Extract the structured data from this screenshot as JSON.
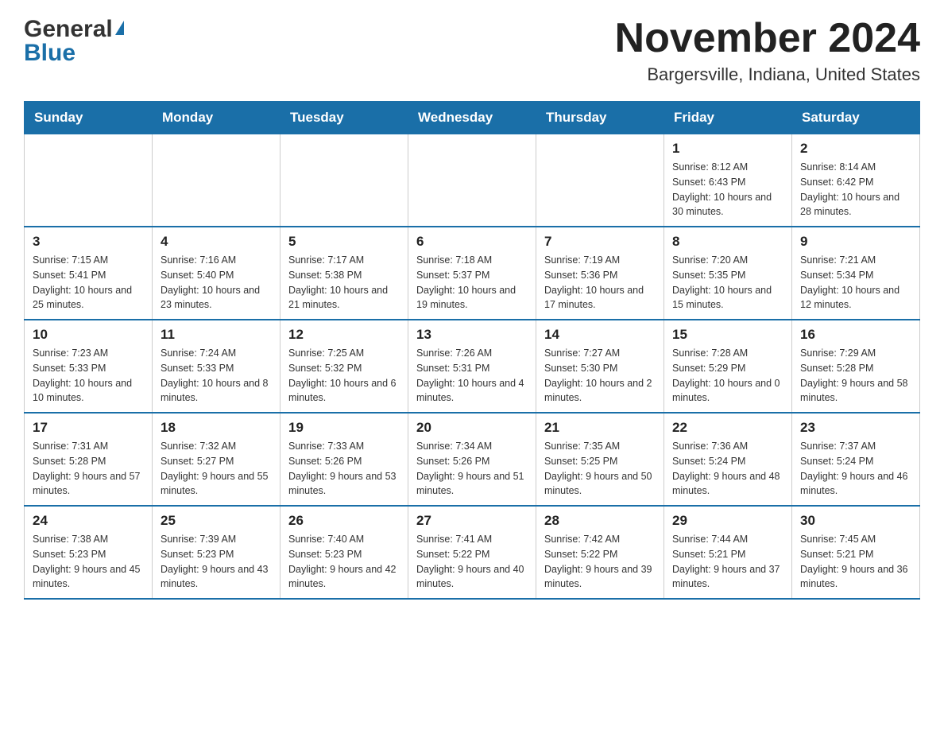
{
  "logo": {
    "general": "General",
    "blue": "Blue"
  },
  "header": {
    "month": "November 2024",
    "location": "Bargersville, Indiana, United States"
  },
  "weekdays": [
    "Sunday",
    "Monday",
    "Tuesday",
    "Wednesday",
    "Thursday",
    "Friday",
    "Saturday"
  ],
  "weeks": [
    [
      {
        "day": "",
        "sunrise": "",
        "sunset": "",
        "daylight": ""
      },
      {
        "day": "",
        "sunrise": "",
        "sunset": "",
        "daylight": ""
      },
      {
        "day": "",
        "sunrise": "",
        "sunset": "",
        "daylight": ""
      },
      {
        "day": "",
        "sunrise": "",
        "sunset": "",
        "daylight": ""
      },
      {
        "day": "",
        "sunrise": "",
        "sunset": "",
        "daylight": ""
      },
      {
        "day": "1",
        "sunrise": "Sunrise: 8:12 AM",
        "sunset": "Sunset: 6:43 PM",
        "daylight": "Daylight: 10 hours and 30 minutes."
      },
      {
        "day": "2",
        "sunrise": "Sunrise: 8:14 AM",
        "sunset": "Sunset: 6:42 PM",
        "daylight": "Daylight: 10 hours and 28 minutes."
      }
    ],
    [
      {
        "day": "3",
        "sunrise": "Sunrise: 7:15 AM",
        "sunset": "Sunset: 5:41 PM",
        "daylight": "Daylight: 10 hours and 25 minutes."
      },
      {
        "day": "4",
        "sunrise": "Sunrise: 7:16 AM",
        "sunset": "Sunset: 5:40 PM",
        "daylight": "Daylight: 10 hours and 23 minutes."
      },
      {
        "day": "5",
        "sunrise": "Sunrise: 7:17 AM",
        "sunset": "Sunset: 5:38 PM",
        "daylight": "Daylight: 10 hours and 21 minutes."
      },
      {
        "day": "6",
        "sunrise": "Sunrise: 7:18 AM",
        "sunset": "Sunset: 5:37 PM",
        "daylight": "Daylight: 10 hours and 19 minutes."
      },
      {
        "day": "7",
        "sunrise": "Sunrise: 7:19 AM",
        "sunset": "Sunset: 5:36 PM",
        "daylight": "Daylight: 10 hours and 17 minutes."
      },
      {
        "day": "8",
        "sunrise": "Sunrise: 7:20 AM",
        "sunset": "Sunset: 5:35 PM",
        "daylight": "Daylight: 10 hours and 15 minutes."
      },
      {
        "day": "9",
        "sunrise": "Sunrise: 7:21 AM",
        "sunset": "Sunset: 5:34 PM",
        "daylight": "Daylight: 10 hours and 12 minutes."
      }
    ],
    [
      {
        "day": "10",
        "sunrise": "Sunrise: 7:23 AM",
        "sunset": "Sunset: 5:33 PM",
        "daylight": "Daylight: 10 hours and 10 minutes."
      },
      {
        "day": "11",
        "sunrise": "Sunrise: 7:24 AM",
        "sunset": "Sunset: 5:33 PM",
        "daylight": "Daylight: 10 hours and 8 minutes."
      },
      {
        "day": "12",
        "sunrise": "Sunrise: 7:25 AM",
        "sunset": "Sunset: 5:32 PM",
        "daylight": "Daylight: 10 hours and 6 minutes."
      },
      {
        "day": "13",
        "sunrise": "Sunrise: 7:26 AM",
        "sunset": "Sunset: 5:31 PM",
        "daylight": "Daylight: 10 hours and 4 minutes."
      },
      {
        "day": "14",
        "sunrise": "Sunrise: 7:27 AM",
        "sunset": "Sunset: 5:30 PM",
        "daylight": "Daylight: 10 hours and 2 minutes."
      },
      {
        "day": "15",
        "sunrise": "Sunrise: 7:28 AM",
        "sunset": "Sunset: 5:29 PM",
        "daylight": "Daylight: 10 hours and 0 minutes."
      },
      {
        "day": "16",
        "sunrise": "Sunrise: 7:29 AM",
        "sunset": "Sunset: 5:28 PM",
        "daylight": "Daylight: 9 hours and 58 minutes."
      }
    ],
    [
      {
        "day": "17",
        "sunrise": "Sunrise: 7:31 AM",
        "sunset": "Sunset: 5:28 PM",
        "daylight": "Daylight: 9 hours and 57 minutes."
      },
      {
        "day": "18",
        "sunrise": "Sunrise: 7:32 AM",
        "sunset": "Sunset: 5:27 PM",
        "daylight": "Daylight: 9 hours and 55 minutes."
      },
      {
        "day": "19",
        "sunrise": "Sunrise: 7:33 AM",
        "sunset": "Sunset: 5:26 PM",
        "daylight": "Daylight: 9 hours and 53 minutes."
      },
      {
        "day": "20",
        "sunrise": "Sunrise: 7:34 AM",
        "sunset": "Sunset: 5:26 PM",
        "daylight": "Daylight: 9 hours and 51 minutes."
      },
      {
        "day": "21",
        "sunrise": "Sunrise: 7:35 AM",
        "sunset": "Sunset: 5:25 PM",
        "daylight": "Daylight: 9 hours and 50 minutes."
      },
      {
        "day": "22",
        "sunrise": "Sunrise: 7:36 AM",
        "sunset": "Sunset: 5:24 PM",
        "daylight": "Daylight: 9 hours and 48 minutes."
      },
      {
        "day": "23",
        "sunrise": "Sunrise: 7:37 AM",
        "sunset": "Sunset: 5:24 PM",
        "daylight": "Daylight: 9 hours and 46 minutes."
      }
    ],
    [
      {
        "day": "24",
        "sunrise": "Sunrise: 7:38 AM",
        "sunset": "Sunset: 5:23 PM",
        "daylight": "Daylight: 9 hours and 45 minutes."
      },
      {
        "day": "25",
        "sunrise": "Sunrise: 7:39 AM",
        "sunset": "Sunset: 5:23 PM",
        "daylight": "Daylight: 9 hours and 43 minutes."
      },
      {
        "day": "26",
        "sunrise": "Sunrise: 7:40 AM",
        "sunset": "Sunset: 5:23 PM",
        "daylight": "Daylight: 9 hours and 42 minutes."
      },
      {
        "day": "27",
        "sunrise": "Sunrise: 7:41 AM",
        "sunset": "Sunset: 5:22 PM",
        "daylight": "Daylight: 9 hours and 40 minutes."
      },
      {
        "day": "28",
        "sunrise": "Sunrise: 7:42 AM",
        "sunset": "Sunset: 5:22 PM",
        "daylight": "Daylight: 9 hours and 39 minutes."
      },
      {
        "day": "29",
        "sunrise": "Sunrise: 7:44 AM",
        "sunset": "Sunset: 5:21 PM",
        "daylight": "Daylight: 9 hours and 37 minutes."
      },
      {
        "day": "30",
        "sunrise": "Sunrise: 7:45 AM",
        "sunset": "Sunset: 5:21 PM",
        "daylight": "Daylight: 9 hours and 36 minutes."
      }
    ]
  ]
}
